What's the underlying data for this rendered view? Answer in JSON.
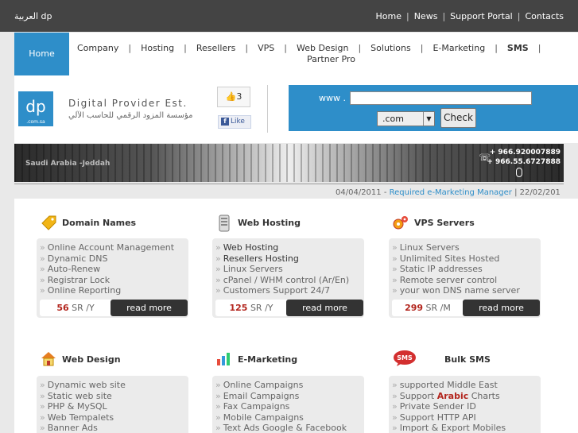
{
  "topbar": {
    "lang": "العربية dp",
    "links": [
      "Home",
      "News",
      "Support Portal",
      "Contacts"
    ]
  },
  "nav": {
    "home": "Home",
    "items": [
      "Company",
      "Hosting",
      "Resellers",
      "VPS",
      "Web Design",
      "Solutions",
      "E-Marketing",
      "SMS"
    ],
    "item2": "Partner Pro"
  },
  "header": {
    "logo_mark": "dp",
    "logo_mark_small": ".com.sa",
    "logo_name": "Digital Provider Est.",
    "logo_arabic": "مؤسسة المزود الرقمي للحاسب الآلي",
    "fb_count": "3",
    "fb_like": "Like",
    "www_label": "www .",
    "www_value": "",
    "tld": ".com",
    "check": "Check"
  },
  "banner": {
    "city": "Saudi Arabia -Jeddah",
    "phone1": "+ 966.920007889",
    "phone2": "+ 966.55.6727888"
  },
  "news": {
    "date1": "04/04/2011",
    "dash": " - ",
    "headline": "Required e-Marketing Manager",
    "sep": " | ",
    "date2": "22/02/201"
  },
  "services": [
    {
      "title": "Domain Names",
      "items": [
        "Online Account Management",
        "Dynamic DNS",
        "Auto-Renew",
        "Registrar Lock",
        "Online Reporting"
      ],
      "price": "56",
      "unit": " SR /Y",
      "read_more": "read more"
    },
    {
      "title": "Web Hosting",
      "items": [
        "Web Hosting",
        "Resellers Hosting",
        "Linux Servers",
        "cPanel / WHM control (Ar/En)",
        "Customers Support 24/7"
      ],
      "price": "125",
      "unit": " SR /Y",
      "read_more": "read more"
    },
    {
      "title": "VPS Servers",
      "items": [
        "Linux Servers",
        "Unlimited Sites Hosted",
        "Static IP addresses",
        "Remote server control",
        "your won DNS name server"
      ],
      "price": "299",
      "unit": " SR /M",
      "read_more": "read more"
    },
    {
      "title": "Web Design",
      "items": [
        "Dynamic web site",
        "Static web site",
        "PHP & MySQL",
        "Web Tempalets",
        "Banner Ads"
      ]
    },
    {
      "title": "E-Marketing",
      "items": [
        "Online Campaigns",
        "Email Campaigns",
        "Fax Campaigns",
        "Mobile Campaigns",
        "Text Ads Google & Facebook"
      ]
    },
    {
      "title": "Bulk SMS",
      "items": [
        "supported Middle East",
        "Support",
        "Arabic",
        "Charts",
        "Private Sender ID",
        "Support HTTP API",
        "Import & Export Mobiles"
      ],
      "sms_badge": "SMS"
    }
  ],
  "colors": {
    "brand": "#2e8ec9",
    "price": "#b3261e",
    "dark": "#333333"
  }
}
